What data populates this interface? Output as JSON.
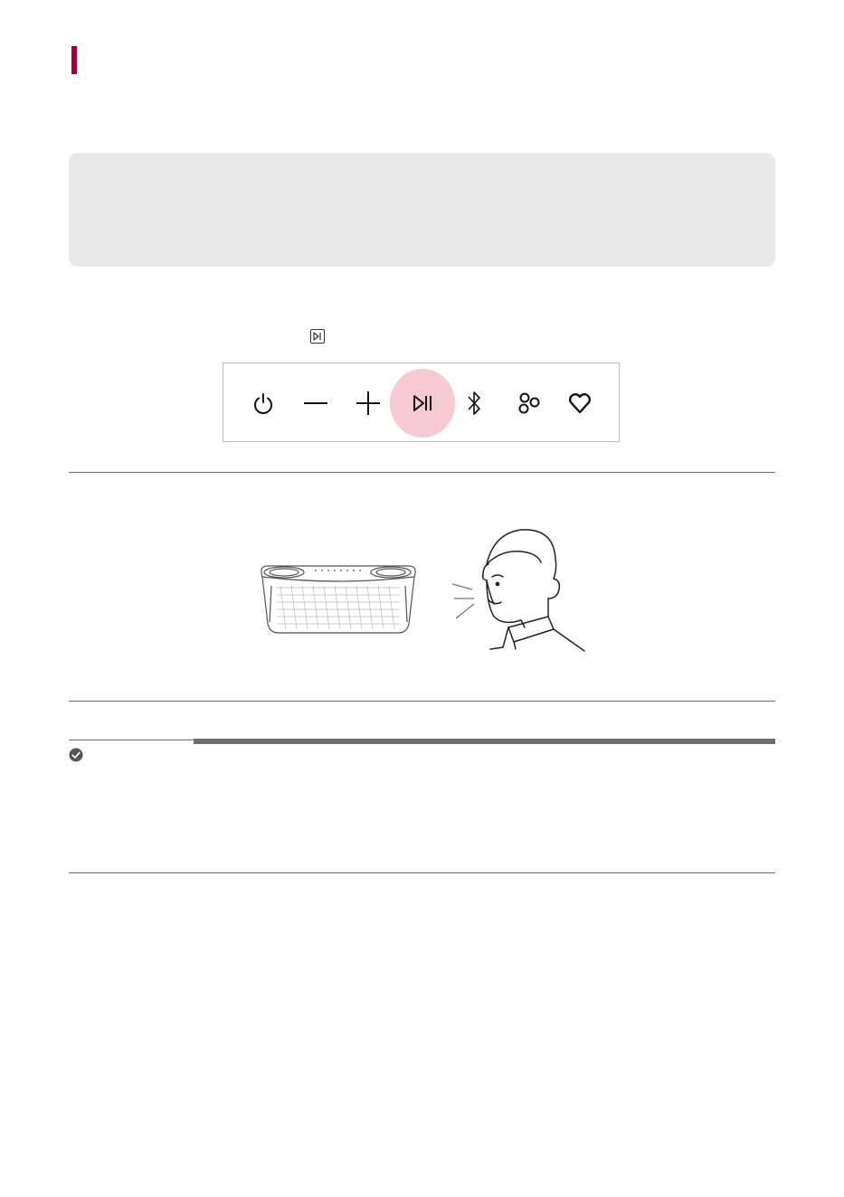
{
  "page": {
    "accent_color": "#a50034",
    "highlight_color": "#f7c9d3",
    "inline_icon": "play-pause-icon"
  },
  "control_panel": {
    "buttons": [
      {
        "icon": "power-icon"
      },
      {
        "icon": "volume-down-icon"
      },
      {
        "icon": "volume-up-icon"
      },
      {
        "icon": "play-pause-icon",
        "highlighted": true
      },
      {
        "icon": "bluetooth-icon"
      },
      {
        "icon": "sound-effect-icon"
      },
      {
        "icon": "favorite-heart-icon"
      }
    ]
  },
  "illustration": {
    "left": "speaker",
    "right": "person-speaking"
  },
  "note": {
    "icon": "checkmark-circle-icon"
  }
}
